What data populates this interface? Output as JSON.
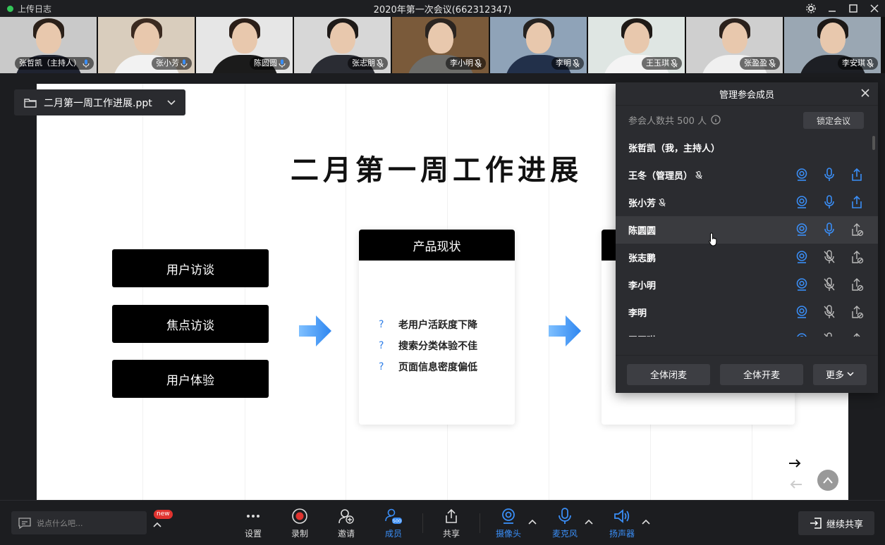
{
  "titlebar": {
    "upload_label": "上传日志",
    "title": "2020年第一次会议(662312347)"
  },
  "video_strip": [
    {
      "name": "张哲凯（主持人）",
      "mic": "on",
      "bg": "#c9c9c9",
      "hair": "#2a2019",
      "body": "#1f2330"
    },
    {
      "name": "张小芳",
      "mic": "on",
      "bg": "#d9cdbd",
      "hair": "#3b2a20",
      "body": "#f2f2f2"
    },
    {
      "name": "陈圆圆",
      "mic": "on",
      "bg": "#e6e6e6",
      "hair": "#2b1e18",
      "body": "#1b1b1b"
    },
    {
      "name": "张志朋",
      "mic": "muted",
      "bg": "#d7d7d7",
      "hair": "#1e1a18",
      "body": "#2a2c33"
    },
    {
      "name": "李小明",
      "mic": "muted",
      "bg": "#7a5a3a",
      "hair": "#2a2420",
      "body": "#6d6d6a"
    },
    {
      "name": "李明",
      "mic": "muted",
      "bg": "#8fa3b8",
      "hair": "#252220",
      "body": "#22304a"
    },
    {
      "name": "王玉琪",
      "mic": "muted",
      "bg": "#dfe6e3",
      "hair": "#1f1a17",
      "body": "#f4f4f4"
    },
    {
      "name": "张盈盈",
      "mic": "muted",
      "bg": "#cfcfcf",
      "hair": "#2b211c",
      "body": "#f0f0f0"
    },
    {
      "name": "李安琪",
      "mic": "muted",
      "bg": "#9aa7b3",
      "hair": "#1c1816",
      "body": "#1d1f24"
    }
  ],
  "document": {
    "name": "二月第一周工作进展.ppt"
  },
  "slide": {
    "title": "二月第一周工作进展",
    "left_buttons": [
      "用户访谈",
      "焦点访谈",
      "用户体验"
    ],
    "card_title": "产品现状",
    "card_items": [
      "老用户活跃度下降",
      "搜索分类体验不佳",
      "页面信息密度偏低"
    ],
    "q_mark": "?",
    "accent": "#2f7fe8"
  },
  "panel": {
    "title": "管理参会成员",
    "count_text": "参会人数共 500 人",
    "lock_label": "锁定会议",
    "members": [
      {
        "name": "张哲凯（我，主持人）",
        "hand": false,
        "controls": false
      },
      {
        "name": "王冬（管理员）",
        "hand": true,
        "controls": true,
        "mic": "on",
        "share": "on"
      },
      {
        "name": "张小芳",
        "hand": true,
        "controls": true,
        "mic": "on",
        "share": "on"
      },
      {
        "name": "陈圆圆",
        "hand": false,
        "controls": true,
        "mic": "on",
        "share": "off",
        "highlight": true
      },
      {
        "name": "张志鹏",
        "hand": false,
        "controls": true,
        "mic": "off",
        "share": "off"
      },
      {
        "name": "李小明",
        "hand": false,
        "controls": true,
        "mic": "off",
        "share": "off"
      },
      {
        "name": "李明",
        "hand": false,
        "controls": true,
        "mic": "off",
        "share": "off"
      },
      {
        "name": "王玉琪",
        "hand": false,
        "controls": true,
        "mic": "off",
        "share": "off"
      }
    ],
    "mute_all": "全体闭麦",
    "unmute_all": "全体开麦",
    "more": "更多"
  },
  "toolbar": {
    "chat_placeholder": "说点什么吧...",
    "new_badge": "new",
    "settings": "设置",
    "record": "录制",
    "invite": "邀请",
    "members": "成员",
    "members_count": "500",
    "share": "共享",
    "camera": "摄像头",
    "mic": "麦克风",
    "speaker": "扬声器",
    "continue_share": "继续共享"
  },
  "colors": {
    "blue": "#3a8ef6",
    "record_red": "#e0332f"
  }
}
